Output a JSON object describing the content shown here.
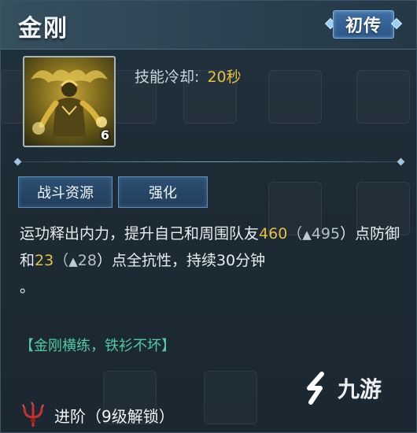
{
  "skill": {
    "name": "金刚",
    "rank": "初传",
    "level_badge": "6",
    "portrait_icon": "golden-warrior-portrait-icon"
  },
  "cooldown": {
    "label": "技能冷却:",
    "value": "20秒"
  },
  "tags": [
    "战斗资源",
    "强化"
  ],
  "description": {
    "p1": "运功释出内力，提升自己和周围队友",
    "v1": "460",
    "p2": "（",
    "u1": "495",
    "p3": "）点防御和",
    "v2": "23",
    "p4": "（",
    "u2": "28",
    "p5": "）点全抗性，持续30分钟",
    "p6": "。"
  },
  "flavor": "【金刚横练，铁衫不坏】",
  "advance": {
    "label": "进阶（9级解锁）",
    "icon": "trident-icon"
  },
  "watermark": {
    "text": "九游",
    "icon": "9game-logo-icon"
  },
  "colors": {
    "highlight": "#e6c046",
    "flavor": "#52c9a4",
    "tag_border": "#5d8fbd"
  }
}
